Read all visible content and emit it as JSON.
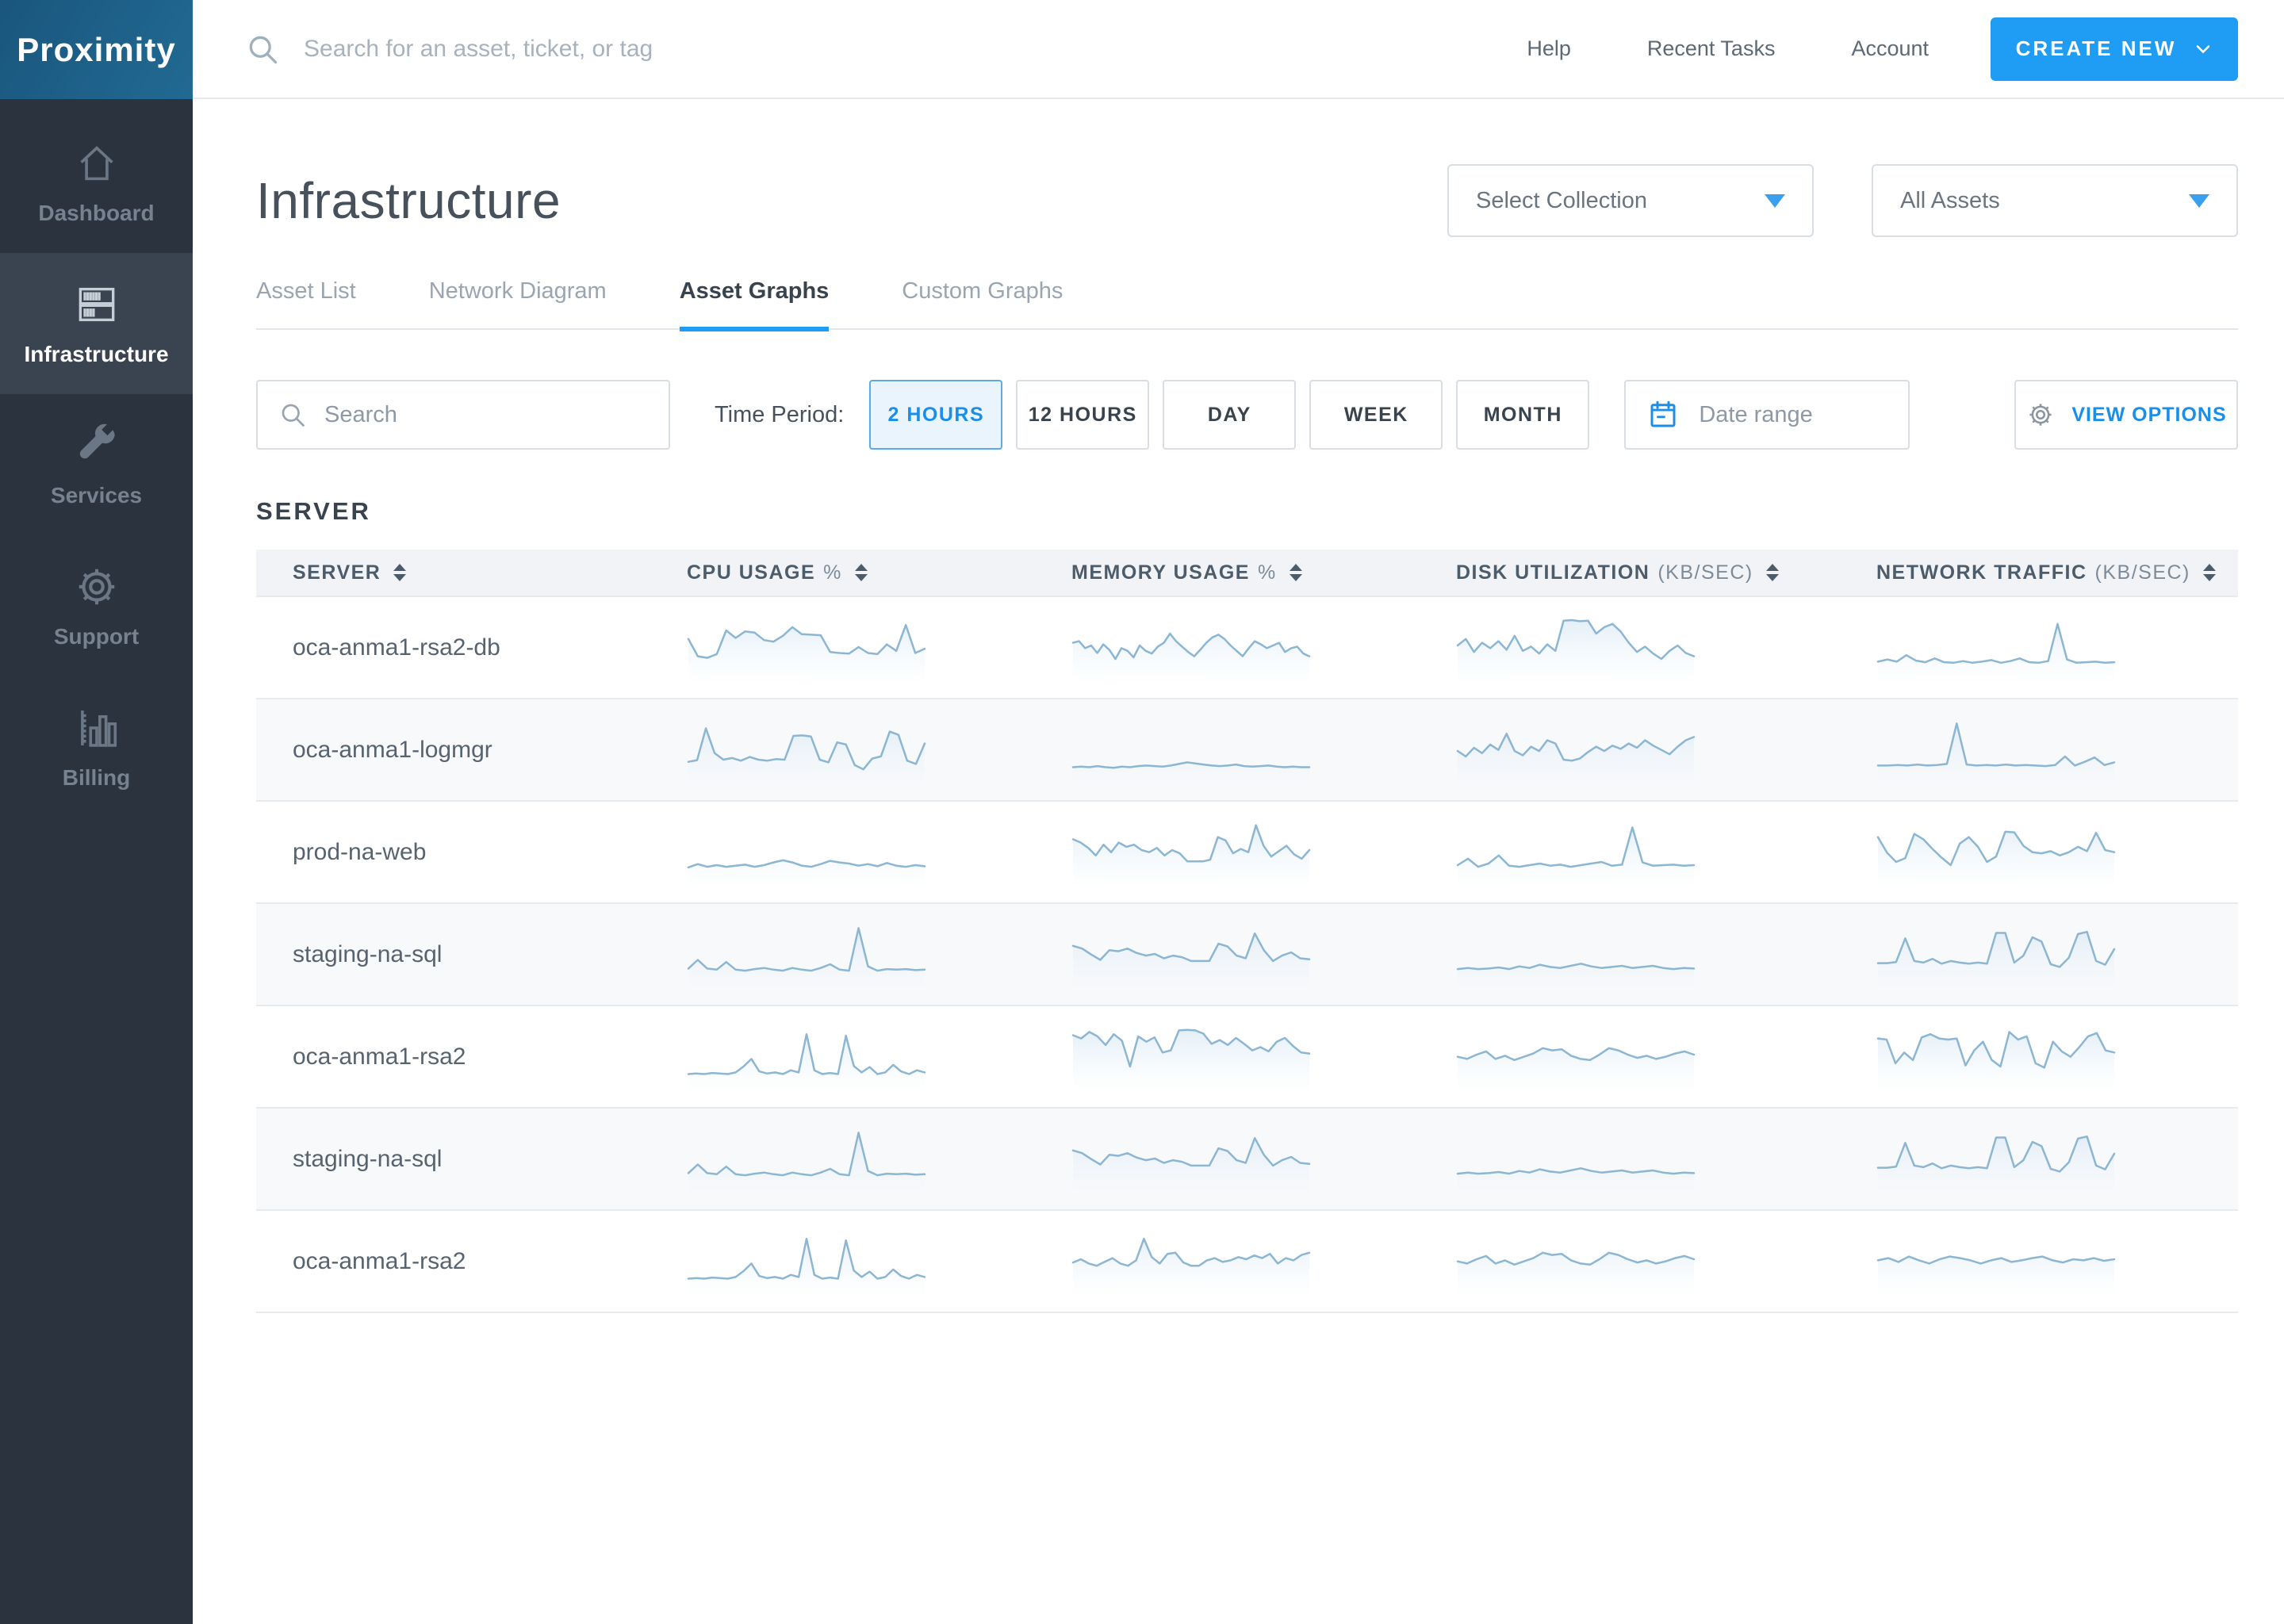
{
  "brand": {
    "logo": "Proximity"
  },
  "topbar": {
    "search_placeholder": "Search for an asset, ticket, or tag",
    "links": [
      "Help",
      "Recent Tasks",
      "Account"
    ],
    "create_button": "CREATE NEW"
  },
  "sidebar": {
    "items": [
      {
        "label": "Dashboard",
        "icon": "home-icon",
        "active": false
      },
      {
        "label": "Infrastructure",
        "icon": "server-rack-icon",
        "active": true
      },
      {
        "label": "Services",
        "icon": "wrench-icon",
        "active": false
      },
      {
        "label": "Support",
        "icon": "gear-icon",
        "active": false
      },
      {
        "label": "Billing",
        "icon": "bar-chart-icon",
        "active": false
      }
    ]
  },
  "header": {
    "title": "Infrastructure",
    "collection_dropdown": "Select Collection",
    "assets_dropdown": "All Assets"
  },
  "tabs": [
    {
      "label": "Asset List",
      "active": false
    },
    {
      "label": "Network Diagram",
      "active": false
    },
    {
      "label": "Asset Graphs",
      "active": true
    },
    {
      "label": "Custom Graphs",
      "active": false
    }
  ],
  "filters": {
    "search_placeholder": "Search",
    "time_period_label": "Time Period:",
    "periods": [
      {
        "label": "2 HOURS",
        "active": true
      },
      {
        "label": "12 HOURS",
        "active": false
      },
      {
        "label": "DAY",
        "active": false
      },
      {
        "label": "WEEK",
        "active": false
      },
      {
        "label": "MONTH",
        "active": false
      }
    ],
    "date_range_placeholder": "Date range",
    "view_options_label": "VIEW OPTIONS"
  },
  "table": {
    "section_title": "SERVER",
    "columns": [
      {
        "label": "SERVER",
        "unit": ""
      },
      {
        "label": "CPU USAGE",
        "unit": "%"
      },
      {
        "label": "MEMORY USAGE",
        "unit": "%"
      },
      {
        "label": "DISK UTILIZATION",
        "unit": "(KB/SEC)"
      },
      {
        "label": "NETWORK TRAFFIC",
        "unit": "(KB/SEC)"
      }
    ],
    "rows": [
      {
        "server": "oca-anma1-rsa2-db",
        "sparklines": {
          "cpu": [
            62,
            30,
            27,
            34,
            78,
            64,
            76,
            74,
            60,
            57,
            68,
            84,
            71,
            70,
            69,
            38,
            36,
            35,
            47,
            36,
            34,
            52,
            40,
            88,
            36,
            44
          ],
          "memory": [
            55,
            58,
            45,
            50,
            36,
            52,
            42,
            25,
            45,
            40,
            28,
            50,
            40,
            35,
            48,
            55,
            72,
            58,
            48,
            38,
            30,
            42,
            55,
            65,
            70,
            62,
            50,
            40,
            30,
            45,
            58,
            52,
            45,
            50,
            55,
            38,
            45,
            48,
            35,
            30
          ],
          "disk": [
            50,
            62,
            38,
            55,
            45,
            58,
            42,
            68,
            40,
            48,
            35,
            52,
            40,
            96,
            97,
            95,
            96,
            72,
            84,
            90,
            76,
            55,
            38,
            48,
            35,
            25,
            40,
            50,
            36,
            30
          ],
          "network": [
            20,
            24,
            20,
            32,
            22,
            19,
            26,
            19,
            18,
            21,
            18,
            20,
            23,
            18,
            21,
            26,
            19,
            18,
            21,
            90,
            24,
            18,
            19,
            20,
            18,
            19
          ]
        }
      },
      {
        "server": "oca-anma1-logmgr",
        "sparklines": {
          "cpu": [
            24,
            27,
            86,
            40,
            28,
            31,
            26,
            33,
            28,
            26,
            29,
            28,
            72,
            73,
            71,
            28,
            23,
            60,
            56,
            18,
            10,
            30,
            34,
            80,
            74,
            26,
            20,
            58
          ],
          "memory": [
            14,
            15,
            14,
            16,
            14,
            13,
            15,
            14,
            16,
            17,
            16,
            15,
            17,
            20,
            23,
            21,
            19,
            17,
            16,
            17,
            19,
            16,
            15,
            16,
            17,
            15,
            14,
            15,
            14,
            14
          ],
          "disk": [
            44,
            34,
            50,
            40,
            56,
            46,
            76,
            44,
            36,
            52,
            44,
            64,
            58,
            28,
            26,
            30,
            42,
            52,
            44,
            54,
            48,
            58,
            50,
            64,
            54,
            46,
            38,
            52,
            64,
            70
          ],
          "network": [
            17,
            17,
            18,
            17,
            19,
            17,
            18,
            20,
            95,
            19,
            17,
            18,
            17,
            19,
            17,
            18,
            17,
            16,
            18,
            34,
            17,
            24,
            32,
            18,
            23
          ]
        }
      },
      {
        "server": "prod-na-web",
        "sparklines": {
          "cpu": [
            18,
            24,
            19,
            22,
            19,
            21,
            23,
            19,
            22,
            27,
            31,
            27,
            21,
            19,
            24,
            30,
            27,
            25,
            21,
            24,
            20,
            26,
            21,
            19,
            22,
            20
          ],
          "memory": [
            70,
            64,
            54,
            40,
            60,
            46,
            64,
            56,
            60,
            50,
            46,
            54,
            40,
            50,
            44,
            29,
            29,
            29,
            32,
            74,
            68,
            44,
            52,
            46,
            96,
            58,
            38,
            48,
            58,
            42,
            34,
            50
          ],
          "disk": [
            22,
            34,
            19,
            25,
            40,
            21,
            19,
            22,
            25,
            21,
            23,
            19,
            22,
            25,
            28,
            21,
            23,
            92,
            27,
            21,
            22,
            23,
            21,
            22
          ],
          "network": [
            74,
            45,
            28,
            35,
            80,
            70,
            52,
            36,
            22,
            62,
            74,
            56,
            28,
            38,
            84,
            83,
            58,
            46,
            44,
            48,
            40,
            46,
            56,
            48,
            82,
            50,
            46
          ]
        }
      },
      {
        "server": "staging-na-sql",
        "sparklines": {
          "cpu": [
            20,
            36,
            20,
            18,
            32,
            18,
            16,
            19,
            21,
            18,
            16,
            21,
            18,
            16,
            21,
            28,
            18,
            16,
            95,
            24,
            16,
            19,
            18,
            19,
            17,
            18
          ],
          "memory": [
            62,
            57,
            46,
            36,
            54,
            52,
            57,
            49,
            44,
            47,
            39,
            44,
            41,
            34,
            34,
            34,
            66,
            61,
            44,
            39,
            85,
            54,
            34,
            44,
            50,
            39,
            37
          ],
          "disk": [
            19,
            21,
            19,
            20,
            22,
            19,
            24,
            21,
            27,
            23,
            21,
            25,
            29,
            24,
            21,
            23,
            25,
            21,
            23,
            25,
            21,
            19,
            21,
            20
          ],
          "network": [
            30,
            30,
            32,
            76,
            34,
            31,
            38,
            29,
            34,
            31,
            29,
            31,
            29,
            86,
            86,
            31,
            44,
            78,
            70,
            28,
            23,
            40,
            84,
            88,
            34,
            27,
            56
          ]
        }
      },
      {
        "server": "oca-anma1-rsa2",
        "sparklines": {
          "cpu": [
            14,
            15,
            14,
            16,
            15,
            14,
            17,
            28,
            42,
            19,
            15,
            17,
            14,
            21,
            17,
            88,
            21,
            14,
            16,
            14,
            85,
            29,
            17,
            27,
            14,
            17,
            31,
            19,
            14,
            21,
            17
          ],
          "memory": [
            86,
            80,
            92,
            84,
            68,
            88,
            76,
            28,
            84,
            74,
            82,
            54,
            58,
            95,
            96,
            95,
            89,
            70,
            77,
            68,
            81,
            70,
            58,
            64,
            56,
            74,
            81,
            66,
            54,
            52
          ],
          "disk": [
            46,
            42,
            50,
            56,
            42,
            48,
            40,
            46,
            52,
            62,
            58,
            60,
            48,
            42,
            40,
            50,
            62,
            58,
            50,
            44,
            48,
            42,
            46,
            52,
            56,
            50
          ],
          "network": [
            80,
            78,
            34,
            54,
            40,
            82,
            88,
            80,
            78,
            80,
            30,
            58,
            74,
            40,
            28,
            92,
            78,
            84,
            34,
            26,
            74,
            56,
            46,
            64,
            84,
            90,
            58,
            54
          ]
        }
      },
      {
        "server": "staging-na-sql",
        "sparklines": {
          "cpu": [
            20,
            36,
            20,
            18,
            32,
            18,
            16,
            19,
            21,
            18,
            16,
            21,
            18,
            16,
            21,
            28,
            18,
            16,
            95,
            24,
            16,
            19,
            18,
            19,
            17,
            18
          ],
          "memory": [
            62,
            57,
            46,
            36,
            54,
            52,
            57,
            49,
            44,
            47,
            39,
            44,
            41,
            34,
            34,
            34,
            66,
            61,
            44,
            39,
            85,
            54,
            34,
            44,
            50,
            39,
            37
          ],
          "disk": [
            19,
            21,
            19,
            20,
            22,
            19,
            24,
            21,
            27,
            23,
            21,
            25,
            29,
            24,
            21,
            23,
            25,
            21,
            23,
            25,
            21,
            19,
            21,
            20
          ],
          "network": [
            30,
            30,
            32,
            76,
            34,
            31,
            38,
            29,
            34,
            31,
            29,
            31,
            29,
            86,
            86,
            31,
            44,
            78,
            70,
            28,
            23,
            40,
            84,
            88,
            34,
            27,
            56
          ]
        }
      },
      {
        "server": "oca-anma1-rsa2",
        "sparklines": {
          "cpu": [
            14,
            15,
            14,
            16,
            15,
            14,
            17,
            28,
            42,
            19,
            15,
            17,
            14,
            21,
            17,
            88,
            21,
            14,
            16,
            14,
            85,
            29,
            17,
            27,
            14,
            17,
            31,
            19,
            14,
            21,
            17
          ],
          "memory": [
            44,
            50,
            42,
            38,
            45,
            52,
            42,
            38,
            48,
            88,
            54,
            42,
            60,
            62,
            44,
            38,
            38,
            48,
            52,
            45,
            48,
            54,
            50,
            57,
            52,
            60,
            42,
            52,
            48,
            58,
            62
          ],
          "disk": [
            46,
            42,
            50,
            56,
            42,
            48,
            40,
            46,
            52,
            62,
            58,
            60,
            48,
            42,
            40,
            50,
            62,
            58,
            50,
            44,
            48,
            42,
            46,
            52,
            56,
            50
          ],
          "network": [
            48,
            52,
            45,
            55,
            48,
            42,
            50,
            55,
            52,
            48,
            42,
            48,
            52,
            45,
            48,
            52,
            55,
            48,
            44,
            50,
            48,
            52,
            47,
            50
          ]
        }
      }
    ]
  },
  "colors": {
    "accent_blue": "#1b8fe8",
    "create_button_blue": "#1f9cf3",
    "logo_bg": "#1d5e87",
    "sidebar_bg": "#2b333f",
    "sidebar_active_bg": "#3a4450",
    "sparkline_stroke": "#8cb6d2",
    "sparkline_fill": "#cfe3f2",
    "table_header_bg": "#f1f3f6",
    "row_alt_bg": "#f8f9fb"
  }
}
